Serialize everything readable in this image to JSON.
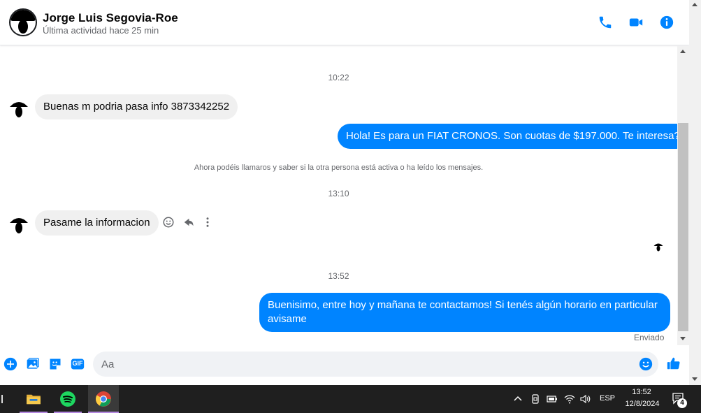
{
  "header": {
    "contact_name": "Jorge Luis Segovia-Roe",
    "status": "Última actividad hace 25 min",
    "icons": [
      "phone-icon",
      "video-camera-icon",
      "info-icon"
    ]
  },
  "conversation": {
    "time_1": "10:22",
    "msg_1": "Buenas m podria pasa info 3873342252",
    "msg_2": "Hola! Es para un FIAT CRONOS. Son cuotas de $197.000. Te interesa?",
    "notice": "Ahora podéis llamaros y saber si la otra persona está activa o ha leído los mensajes.",
    "time_2": "13:10",
    "msg_3": "Pasame la informacion",
    "time_3": "13:52",
    "msg_4": "Buenisimo, entre hoy y mañana te contactamos! Si tenés algún horario en particular avisame",
    "sent_status": "Enviado"
  },
  "composer": {
    "placeholder": "Aa",
    "gif_label": "GIF",
    "icons": [
      "plus-icon",
      "image-icon",
      "sticker-icon",
      "gif-icon",
      "emoji-icon",
      "like-icon"
    ]
  },
  "taskbar": {
    "apps": [
      "file-explorer-icon",
      "spotify-icon",
      "chrome-icon"
    ],
    "language": "ESP",
    "time": "13:52",
    "date": "12/8/2024",
    "notifications": "4"
  },
  "colors": {
    "accent": "#0084ff",
    "incoming_bubble": "#f0f0f0",
    "taskbar": "#1f1f1f"
  }
}
